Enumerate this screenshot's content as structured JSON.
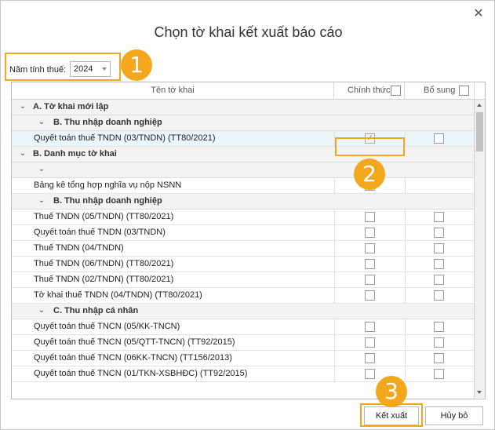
{
  "dialog": {
    "title": "Chọn tờ khai kết xuất báo cáo",
    "close_icon": "close-icon"
  },
  "year": {
    "label": "Năm tính thuế:",
    "value": "2024"
  },
  "badges": [
    "1",
    "2",
    "3"
  ],
  "grid": {
    "headers": {
      "name": "Tên tờ khai",
      "main": "Chính thức",
      "supplement": "Bổ sung"
    },
    "rows": [
      {
        "type": "group",
        "level": 0,
        "label": "A. Tờ khai mới lập"
      },
      {
        "type": "group",
        "level": 1,
        "label": "B. Thu nhập doanh nghiệp"
      },
      {
        "type": "item",
        "label": "Quyết toán thuế TNDN (03/TNDN) (TT80/2021)",
        "main": true,
        "supp": false,
        "selected": true,
        "has_supp": true
      },
      {
        "type": "group",
        "level": 0,
        "label": "B. Danh mục tờ khai"
      },
      {
        "type": "group",
        "level": 1,
        "label": ""
      },
      {
        "type": "item",
        "label": "Bảng kê tổng hợp nghĩa vụ nộp NSNN",
        "main": false,
        "supp": false,
        "selected": false,
        "has_supp": false
      },
      {
        "type": "group",
        "level": 1,
        "label": "B. Thu nhập doanh nghiệp"
      },
      {
        "type": "item",
        "label": "Thuế TNDN (05/TNDN) (TT80/2021)",
        "main": false,
        "supp": false,
        "selected": false,
        "has_supp": true
      },
      {
        "type": "item",
        "label": "Quyết toán thuế TNDN (03/TNDN)",
        "main": false,
        "supp": false,
        "selected": false,
        "has_supp": true
      },
      {
        "type": "item",
        "label": "Thuế TNDN (04/TNDN)",
        "main": false,
        "supp": false,
        "selected": false,
        "has_supp": true
      },
      {
        "type": "item",
        "label": "Thuế TNDN (06/TNDN) (TT80/2021)",
        "main": false,
        "supp": false,
        "selected": false,
        "has_supp": true
      },
      {
        "type": "item",
        "label": "Thuế TNDN (02/TNDN) (TT80/2021)",
        "main": false,
        "supp": false,
        "selected": false,
        "has_supp": true
      },
      {
        "type": "item",
        "label": "Tờ khai thuế TNDN (04/TNDN) (TT80/2021)",
        "main": false,
        "supp": false,
        "selected": false,
        "has_supp": true
      },
      {
        "type": "group",
        "level": 1,
        "label": "C. Thu nhập cá nhân"
      },
      {
        "type": "item",
        "label": "Quyết toán thuế TNCN (05/KK-TNCN)",
        "main": false,
        "supp": false,
        "selected": false,
        "has_supp": true
      },
      {
        "type": "item",
        "label": "Quyết toán thuế TNCN (05/QTT-TNCN) (TT92/2015)",
        "main": false,
        "supp": false,
        "selected": false,
        "has_supp": true
      },
      {
        "type": "item",
        "label": "Quyết toán thuế TNCN (06KK-TNCN) (TT156/2013)",
        "main": false,
        "supp": false,
        "selected": false,
        "has_supp": true
      },
      {
        "type": "item",
        "label": "Quyết toán thuế TNCN (01/TKN-XSBHĐC) (TT92/2015)",
        "main": false,
        "supp": false,
        "selected": false,
        "has_supp": true
      }
    ]
  },
  "footer": {
    "export_label": "Kết xuất",
    "cancel_label": "Hủy bỏ"
  },
  "colors": {
    "highlight": "#f0a820",
    "badge": "#f2a71c",
    "selected_row": "#eaf6fb",
    "group_row": "#f3f3f3"
  }
}
